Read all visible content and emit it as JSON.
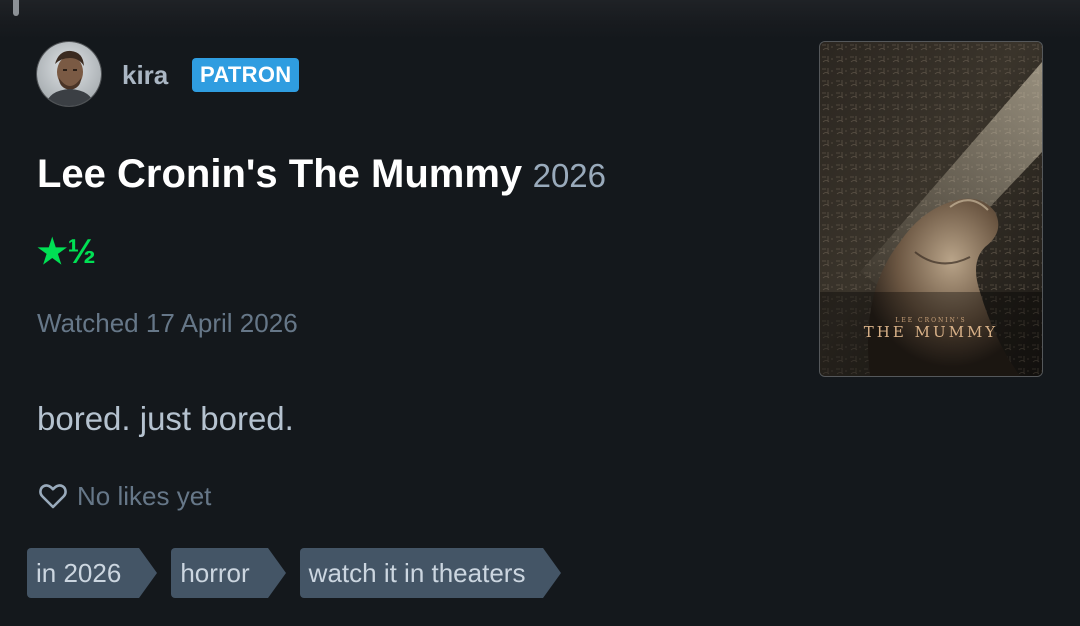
{
  "user": {
    "name": "kira",
    "badge": "PATRON"
  },
  "film": {
    "title": "Lee Cronin's The Mummy",
    "year": "2026",
    "rating_display": "★½",
    "rating_stars": 1.5,
    "rating_max": 5
  },
  "watched": "Watched 17 April 2026",
  "review": "bored. just bored.",
  "likes": {
    "text": "No likes yet",
    "icon": "heart-outline-icon"
  },
  "tags": [
    {
      "label": "in 2026"
    },
    {
      "label": "horror"
    },
    {
      "label": "watch it in theaters"
    }
  ],
  "poster": {
    "credit": "LEE CRONIN'S",
    "title": "THE MUMMY"
  },
  "colors": {
    "background": "#14181c",
    "rating_green": "#00e054",
    "badge_blue": "#2f9de0",
    "tag_bg": "#445566"
  }
}
